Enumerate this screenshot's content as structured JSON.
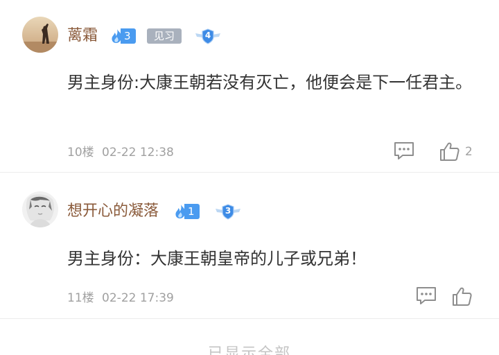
{
  "comments": [
    {
      "username": "蓠霜",
      "flame_level": "3",
      "tag": "见习",
      "level_badge": "4",
      "content": "男主身份:大康王朝若没有灭亡，他便会是下一任君主。",
      "floor": "10楼",
      "time": "02-22 12:38",
      "like_count": "2"
    },
    {
      "username": "想开心的凝落",
      "flame_level": "1",
      "level_badge": "3",
      "content": "男主身份：大康王朝皇帝的儿子或兄弟！",
      "floor": "11楼",
      "time": "02-22 17:39"
    }
  ],
  "footer": {
    "show_all_label": "已显示全部"
  },
  "colors": {
    "username": "#8a5a3a",
    "flame_badge": "#4a9bf0",
    "tag_bg": "#a9b1bd",
    "text": "#333333",
    "meta": "#a0a0a0"
  },
  "icons": [
    "flame-icon",
    "level-badge-icon",
    "comment-icon",
    "thumbs-up-icon"
  ]
}
